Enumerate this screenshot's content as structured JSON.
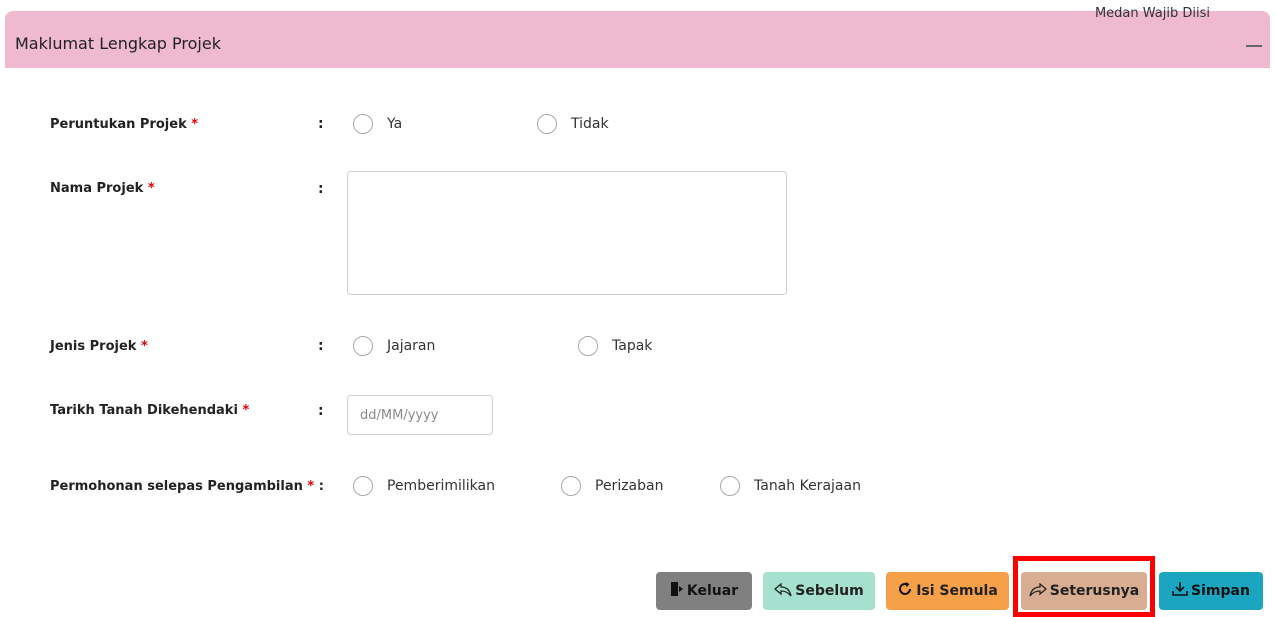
{
  "panel": {
    "title": "Maklumat Lengkap Projek",
    "required_note": "Medan Wajib Diisi"
  },
  "fields": {
    "peruntukan": {
      "label": "Peruntukan Projek",
      "required_mark": "*",
      "colon": ":",
      "options": [
        "Ya",
        "Tidak"
      ]
    },
    "nama": {
      "label": "Nama Projek",
      "required_mark": "*",
      "colon": ":",
      "value": ""
    },
    "jenis": {
      "label": "Jenis Projek",
      "required_mark": "*",
      "colon": ":",
      "options": [
        "Jajaran",
        "Tapak"
      ]
    },
    "tarikh": {
      "label": "Tarikh Tanah Dikehendaki",
      "required_mark": "*",
      "colon": ":",
      "placeholder": "dd/MM/yyyy"
    },
    "permohonan": {
      "label": "Permohonan selepas Pengambilan",
      "required_mark": "*",
      "colon": ":",
      "options": [
        "Pemberimilikan",
        "Perizaban",
        "Tanah Kerajaan"
      ]
    }
  },
  "buttons": {
    "keluar": "Keluar",
    "sebelum": "Sebelum",
    "isi_semula": "Isi Semula",
    "seterusnya": "Seterusnya",
    "simpan": "Simpan"
  },
  "colors": {
    "header_bg": "#efb9d0",
    "required": "#e00000",
    "highlight": "#ff0000"
  }
}
